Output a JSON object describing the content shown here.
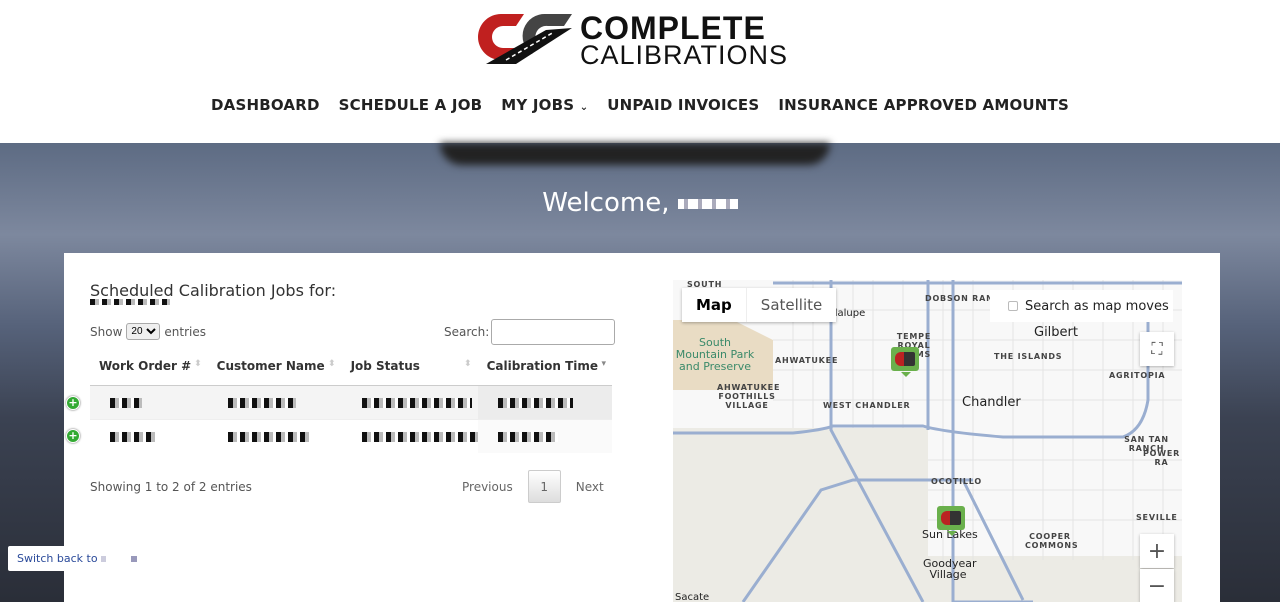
{
  "brand": {
    "line1": "COMPLETE",
    "line2": "CALIBRATIONS",
    "colors": {
      "red": "#c0201f",
      "dark": "#222222"
    }
  },
  "nav": [
    {
      "label": "DASHBOARD"
    },
    {
      "label": "SCHEDULE A JOB"
    },
    {
      "label": "MY JOBS"
    },
    {
      "label": "UNPAID INVOICES"
    },
    {
      "label": "INSURANCE APPROVED AMOUNTS"
    }
  ],
  "welcome": "Welcome,",
  "jobs": {
    "title": "Scheduled Calibration Jobs for:",
    "show_label": "Show",
    "entries_label": "entries",
    "page_size": "20",
    "search_label": "Search:",
    "search_value": "",
    "columns": [
      "Work Order #",
      "Customer Name",
      "Job Status",
      "Calibration Time"
    ],
    "info": "Showing 1 to 2 of 2 entries",
    "prev": "Previous",
    "page": "1",
    "next": "Next"
  },
  "switch_back": "Switch back to",
  "map": {
    "tab_map": "Map",
    "tab_satellite": "Satellite",
    "search_moves": "Search as map moves",
    "labels": [
      "SOUTH",
      "DOBSON RANCH",
      "adalupe",
      "TEMPE ROYAL PALMS",
      "AHWATUKEE",
      "AHWATUKEE FOOTHILLS VILLAGE",
      "WEST CHANDLER",
      "THE ISLANDS",
      "AGRITOPIA",
      "SAN TAN RANCH",
      "POWER RA",
      "OCOTILLO",
      "SEVILLE",
      "COOPER COMMONS",
      "Sacate"
    ],
    "cities": [
      "Gilbert",
      "Chandler",
      "Sun Lakes",
      "Goodyear Village"
    ],
    "park": "South Mountain Park and Preserve",
    "zoom_in": "+",
    "zoom_out": "−"
  }
}
